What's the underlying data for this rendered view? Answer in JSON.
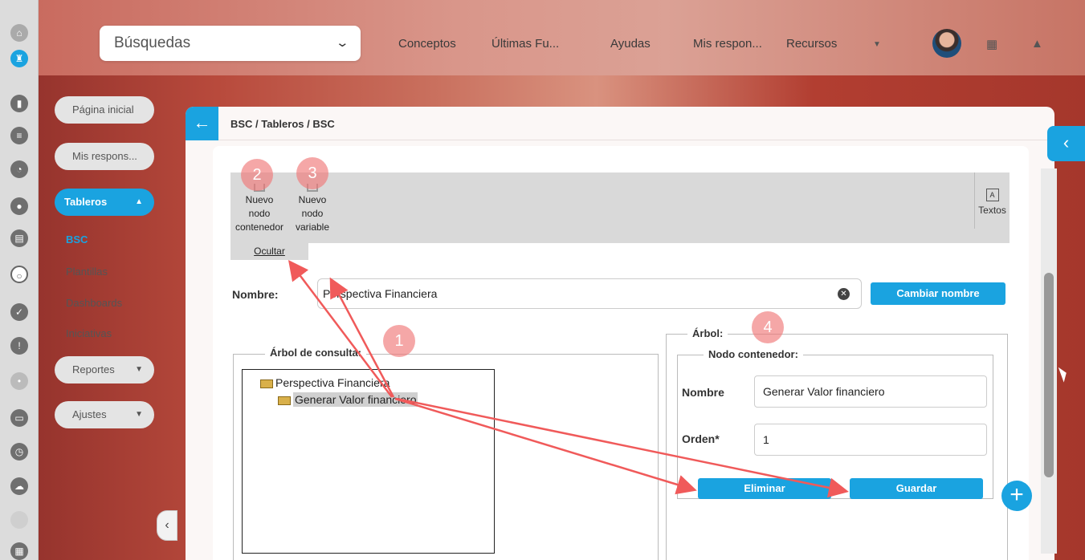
{
  "topbar": {
    "search_label": "Búsquedas",
    "links": [
      "Conceptos",
      "Últimas Fu...",
      "Ayudas",
      "Mis respon...",
      "Recursos"
    ]
  },
  "sidemenu": {
    "home": "Página inicial",
    "mis": "Mis respons...",
    "tableros": "Tableros",
    "sub_items": [
      "BSC",
      "Plantillas",
      "Dashboards",
      "Iniciativas"
    ],
    "reportes": "Reportes",
    "ajustes": "Ajustes"
  },
  "panel": {
    "breadcrumb": "BSC / Tableros / BSC"
  },
  "toolbar": {
    "nuevo_contenedor": [
      "Nuevo",
      "nodo",
      "contenedor"
    ],
    "nuevo_variable": [
      "Nuevo",
      "nodo",
      "variable"
    ],
    "textos": "Textos",
    "ocultar": "Ocultar"
  },
  "form": {
    "nombre_label": "Nombre:",
    "nombre_value": "Perspectiva Financiera",
    "cambiar": "Cambiar nombre"
  },
  "tree": {
    "legend": "Árbol de consulta:",
    "root": "Perspectiva Financiera",
    "child": "Generar Valor financiero"
  },
  "arbol": {
    "legend": "Árbol:",
    "sub_legend": "Nodo contenedor:",
    "nombre_label": "Nombre",
    "nombre_value": "Generar Valor financiero",
    "orden_label": "Orden*",
    "orden_value": "1",
    "eliminar": "Eliminar",
    "guardar": "Guardar"
  },
  "badges": [
    "1",
    "2",
    "3",
    "4"
  ],
  "colors": {
    "accent": "#1aa3e0",
    "arrow": "#f05a5a"
  }
}
